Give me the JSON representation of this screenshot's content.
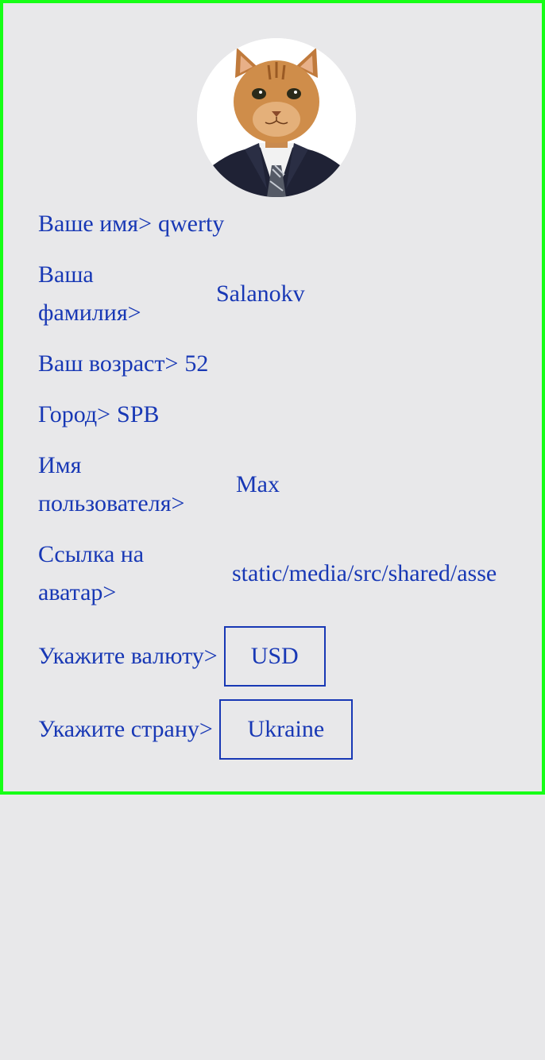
{
  "profile": {
    "avatar_icon": "cat-in-suit-avatar",
    "name_label": "Ваше имя>",
    "name_value": "qwerty",
    "surname_label": "Ваша фамилия>",
    "surname_value": "Salanokv",
    "age_label": "Ваш возраст>",
    "age_value": "52",
    "city_label": "Город>",
    "city_value": "SPB",
    "username_label": "Имя пользователя>",
    "username_value": "Max",
    "avatar_link_label": "Ссылка на аватар>",
    "avatar_link_value": "static/media/src/shared/asse",
    "currency_label": "Укажите валюту>",
    "currency_value": "USD",
    "country_label": "Укажите страну>",
    "country_value": "Ukraine"
  },
  "colors": {
    "text": "#1838b5",
    "border": "#16ff16",
    "background": "#e8e8ea"
  }
}
